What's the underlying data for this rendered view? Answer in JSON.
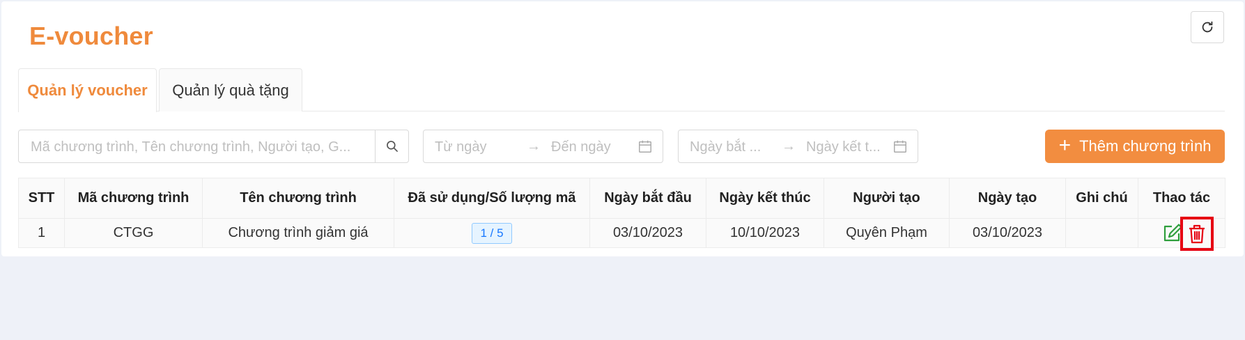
{
  "page": {
    "title": "E-voucher"
  },
  "tabs": [
    {
      "label": "Quản lý voucher",
      "active": true
    },
    {
      "label": "Quản lý quà tặng",
      "active": false
    }
  ],
  "filters": {
    "search_placeholder": "Mã chương trình, Tên chương trình, Người tạo, G...",
    "created_range": {
      "from_placeholder": "Từ ngày",
      "to_placeholder": "Đến ngày"
    },
    "period_range": {
      "from_placeholder": "Ngày bắt ...",
      "to_placeholder": "Ngày kết t..."
    },
    "range_separator": "→"
  },
  "add_button": {
    "label": "Thêm chương trình",
    "icon": "plus-icon"
  },
  "table": {
    "columns": [
      "STT",
      "Mã chương trình",
      "Tên chương trình",
      "Đã sử dụng/Số lượng mã",
      "Ngày bắt đầu",
      "Ngày kết thúc",
      "Người tạo",
      "Ngày tạo",
      "Ghi chú",
      "Thao tác"
    ],
    "rows": [
      {
        "stt": "1",
        "code": "CTGG",
        "name": "Chương trình giảm giá",
        "usage": "1 / 5",
        "start_date": "03/10/2023",
        "end_date": "10/10/2023",
        "creator": "Quyên Phạm",
        "created_date": "03/10/2023",
        "note": ""
      }
    ]
  },
  "colors": {
    "accent": "#ef8a3c",
    "add_button_bg": "#f28d40",
    "edit_icon": "#2e9e3c",
    "delete_icon": "#e60012",
    "highlight_box": "#e60012",
    "badge_text": "#1677ff"
  }
}
